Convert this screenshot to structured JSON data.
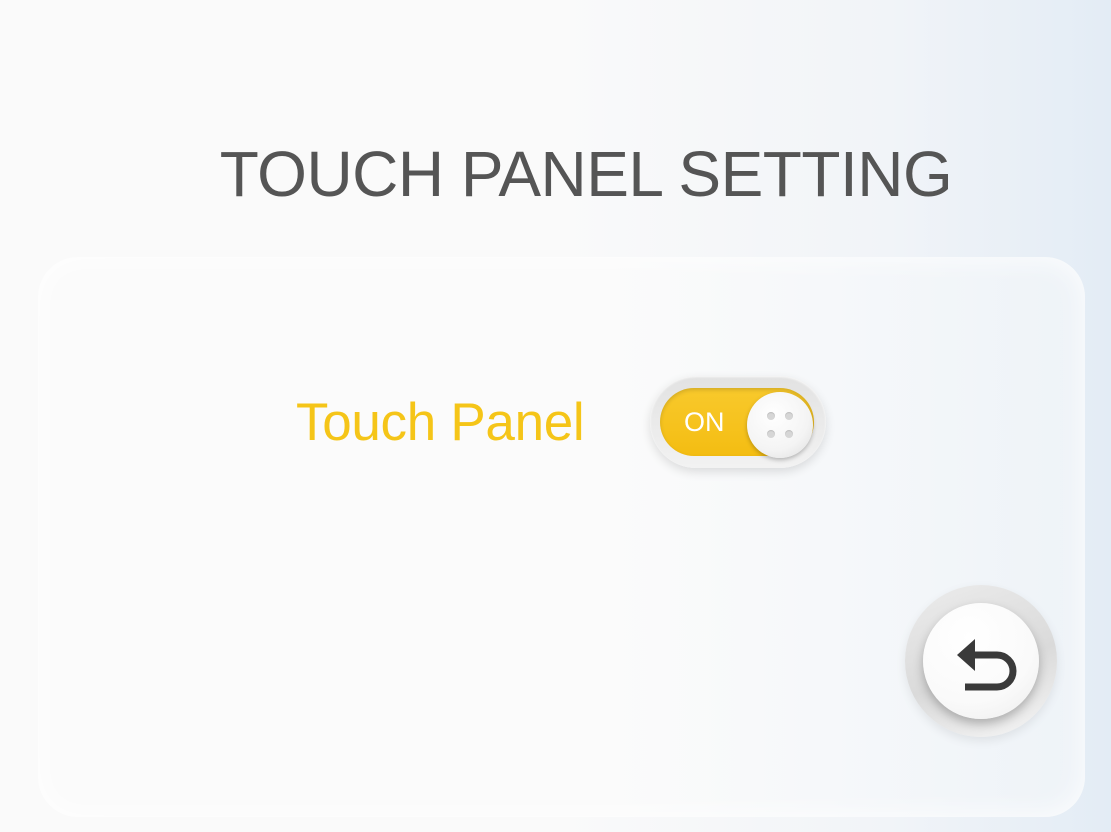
{
  "header": {
    "title": "TOUCH PANEL SETTING"
  },
  "settings": {
    "touch_panel": {
      "label": "Touch Panel",
      "toggle_text": "ON",
      "enabled": true
    }
  },
  "navigation": {
    "back_icon": "back-arrow-icon"
  },
  "colors": {
    "accent": "#F5C518",
    "title_text": "#555555",
    "icon": "#3a3a3a"
  }
}
